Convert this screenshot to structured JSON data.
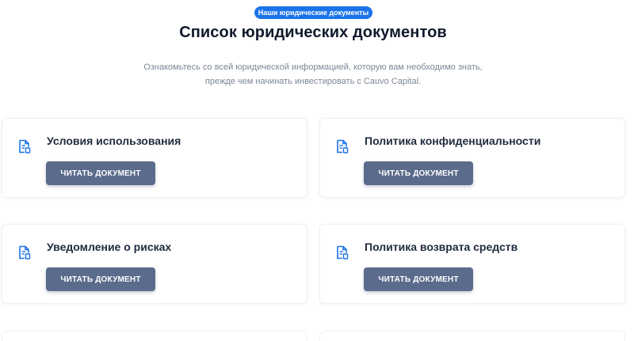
{
  "header": {
    "badge": "Наши юридические документы",
    "title": "Список юридических документов",
    "subtitle": "Ознакомьтесь со всей юридической информацией, которую вам необходимо знать, прежде чем начинать инвестировать с Cauvo Capital."
  },
  "documents": [
    {
      "title": "Условия использования",
      "button_label": "ЧИТАТЬ ДОКУМЕНТ"
    },
    {
      "title": "Политика конфиденциальности",
      "button_label": "ЧИТАТЬ ДОКУМЕНТ"
    },
    {
      "title": "Уведомление о рисках",
      "button_label": "ЧИТАТЬ ДОКУМЕНТ"
    },
    {
      "title": "Политика возврата средств",
      "button_label": "ЧИТАТЬ ДОКУМЕНТ"
    }
  ],
  "icons": {
    "document": "document-icon"
  },
  "colors": {
    "accent": "#1a73e8",
    "button": "#5b6b8c",
    "title": "#111a2c",
    "muted": "#7c8798"
  }
}
